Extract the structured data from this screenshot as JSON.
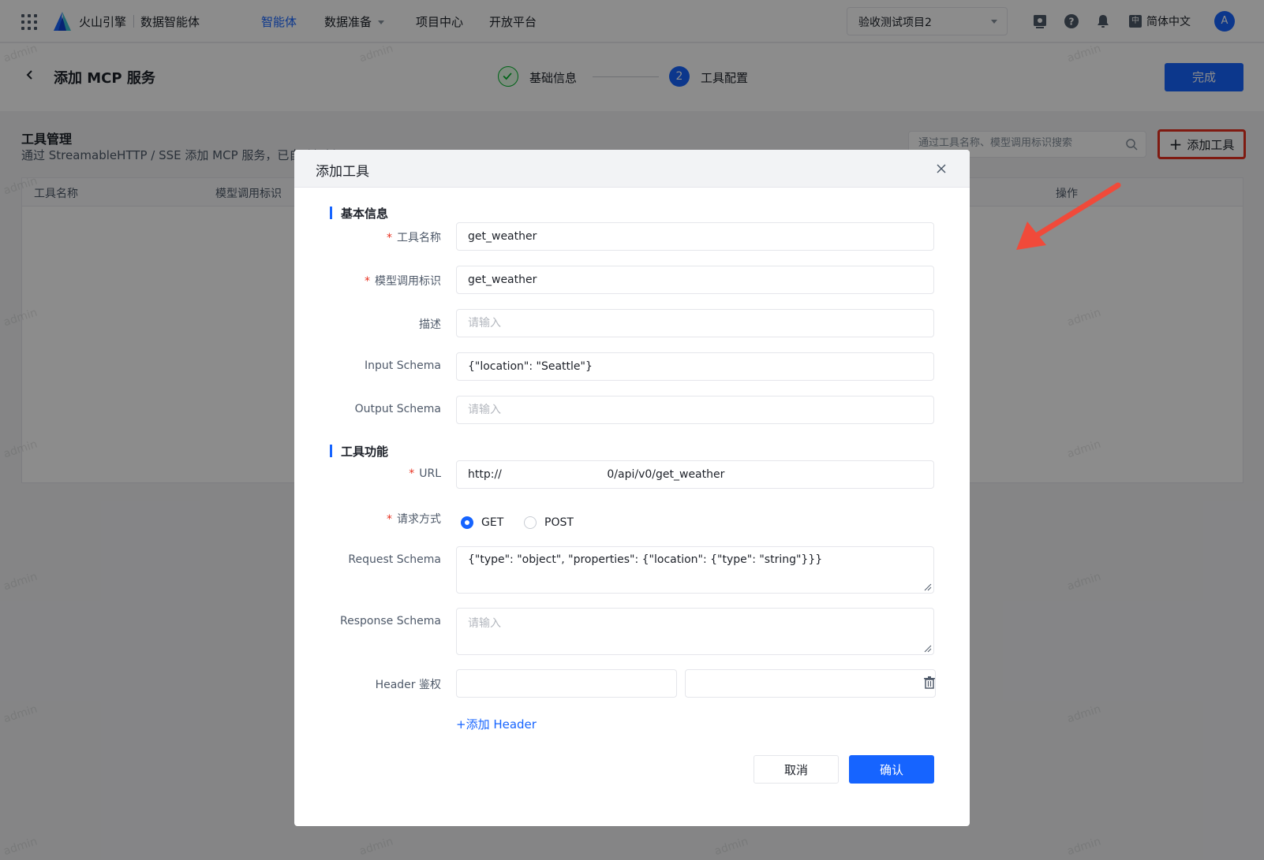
{
  "topnav": {
    "brand": "火山引擎",
    "product": "数据智能体",
    "nav": [
      {
        "label": "智能体",
        "active": true
      },
      {
        "label": "数据准备",
        "active": false
      },
      {
        "label": "项目中心",
        "active": false
      },
      {
        "label": "开放平台",
        "active": false
      }
    ],
    "project": "验收测试项目2",
    "language": "简体中文",
    "language_icon": "中",
    "avatar": "A"
  },
  "header": {
    "title": "添加 MCP 服务",
    "steps": [
      {
        "label": "基础信息",
        "status": "done"
      },
      {
        "number": "2",
        "label": "工具配置",
        "status": "current"
      }
    ],
    "done_button": "完成"
  },
  "tools": {
    "title": "工具管理",
    "description": "通过 StreamableHTTP / SSE 添加 MCP 服务，已自动解析以下工具",
    "search_placeholder": "通过工具名称、模型调用标识搜索",
    "add_button": "添加工具",
    "columns": [
      "工具名称",
      "模型调用标识",
      "操作"
    ]
  },
  "watermark": "admin",
  "modal": {
    "title": "添加工具",
    "basic_section": "基本信息",
    "function_section": "工具功能",
    "fields": {
      "name": {
        "label": "工具名称",
        "value": "get_weather"
      },
      "identifier": {
        "label": "模型调用标识",
        "value": "get_weather"
      },
      "description": {
        "label": "描述",
        "value": "",
        "placeholder": "请输入"
      },
      "input_schema": {
        "label": "Input Schema",
        "value": "{\"location\": \"Seattle\"}"
      },
      "output_schema": {
        "label": "Output Schema",
        "value": "",
        "placeholder": "请输入"
      },
      "url": {
        "label": "URL",
        "value": "http://                              0/api/v0/get_weather"
      },
      "method": {
        "label": "请求方式",
        "options": [
          "GET",
          "POST"
        ],
        "selected": "GET"
      },
      "request_schema": {
        "label": "Request Schema",
        "value": "{\"type\": \"object\", \"properties\": {\"location\": {\"type\": \"string\"}}}"
      },
      "response_schema": {
        "label": "Response Schema",
        "value": "",
        "placeholder": "请输入"
      },
      "header_auth": {
        "label": "Header 鉴权",
        "key": "",
        "value": ""
      }
    },
    "add_header": "+添加 Header",
    "cancel": "取消",
    "confirm": "确认"
  },
  "colors": {
    "primary": "#1664ff",
    "required": "#e8301f",
    "success": "#00b42a",
    "highlight": "#e8301f"
  }
}
